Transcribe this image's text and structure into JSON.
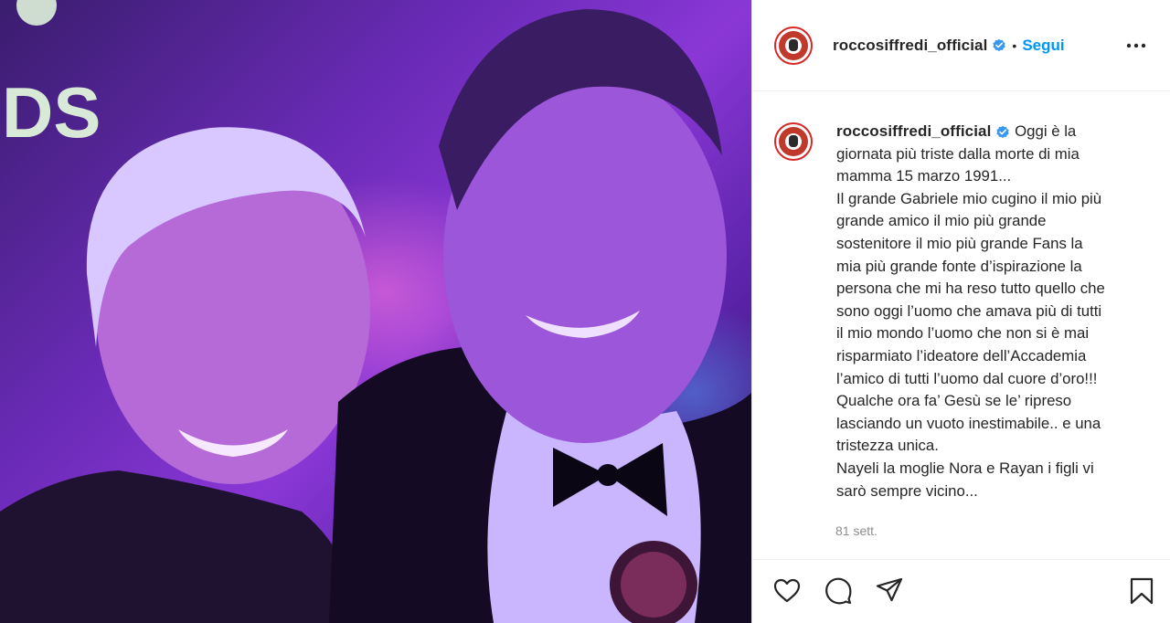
{
  "post": {
    "username": "roccosiffredi_official",
    "verified": true,
    "follow_label": "Segui",
    "separator": "•",
    "time_ago": "81 sett.",
    "caption_first_line": "Oggi è la",
    "caption_lines": [
      "giornata più triste dalla morte di mia",
      "mamma 15 marzo 1991...",
      "Il grande Gabriele mio cugino il mio più",
      "grande amico il mio più grande",
      "sostenitore il mio più grande Fans la",
      "mia più grande fonte d’ispirazione la",
      "persona che mi ha reso tutto quello che",
      "sono oggi l’uomo che amava più di tutti",
      "il mio mondo l’uomo che non si è mai",
      "risparmiato l’ideatore dell’Accademia",
      "l’amico di tutti l’uomo dal cuore d’oro!!!",
      "Qualche ora fa’ Gesù se le’ ripreso",
      "lasciando un vuoto inestimabile.. e una",
      "tristezza unica.",
      "Nayeli la moglie Nora e Rayan i figli vi",
      "sarò sempre vicino..."
    ],
    "photo_sign_text": "DS"
  },
  "icons": {
    "verified": "verified-badge-icon",
    "more": "more-options-icon",
    "like": "heart-icon",
    "comment": "comment-icon",
    "share": "share-icon",
    "save": "bookmark-icon"
  },
  "colors": {
    "accent": "#0095f6",
    "text": "#262626",
    "muted": "#8e8e8e",
    "border": "#dbdbdb"
  }
}
